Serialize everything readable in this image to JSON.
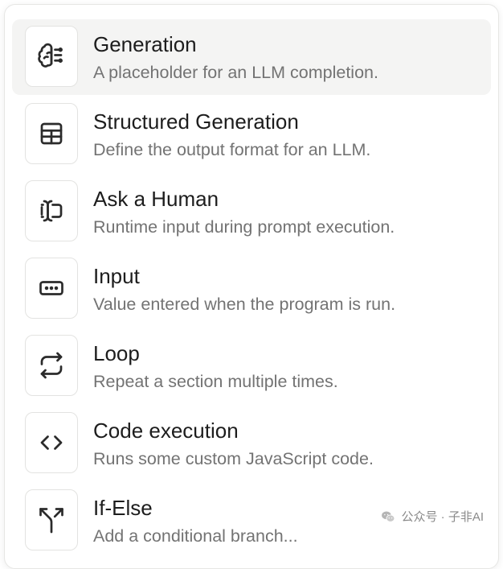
{
  "menu": {
    "items": [
      {
        "title": "Generation",
        "description": "A placeholder for an LLM completion.",
        "icon": "brain-icon",
        "active": true
      },
      {
        "title": "Structured Generation",
        "description": "Define the output format for an LLM.",
        "icon": "table-icon",
        "active": false
      },
      {
        "title": "Ask a Human",
        "description": "Runtime input during prompt execution.",
        "icon": "text-cursor-input-icon",
        "active": false
      },
      {
        "title": "Input",
        "description": "Value entered when the program is run.",
        "icon": "input-field-icon",
        "active": false
      },
      {
        "title": "Loop",
        "description": "Repeat a section multiple times.",
        "icon": "repeat-icon",
        "active": false
      },
      {
        "title": "Code execution",
        "description": "Runs some custom JavaScript code.",
        "icon": "code-icon",
        "active": false
      },
      {
        "title": "If-Else",
        "description": "Add a conditional branch...",
        "icon": "split-icon",
        "active": false
      }
    ]
  },
  "watermark": {
    "text": "公众号 · 子非AI",
    "icon": "wechat-icon"
  }
}
